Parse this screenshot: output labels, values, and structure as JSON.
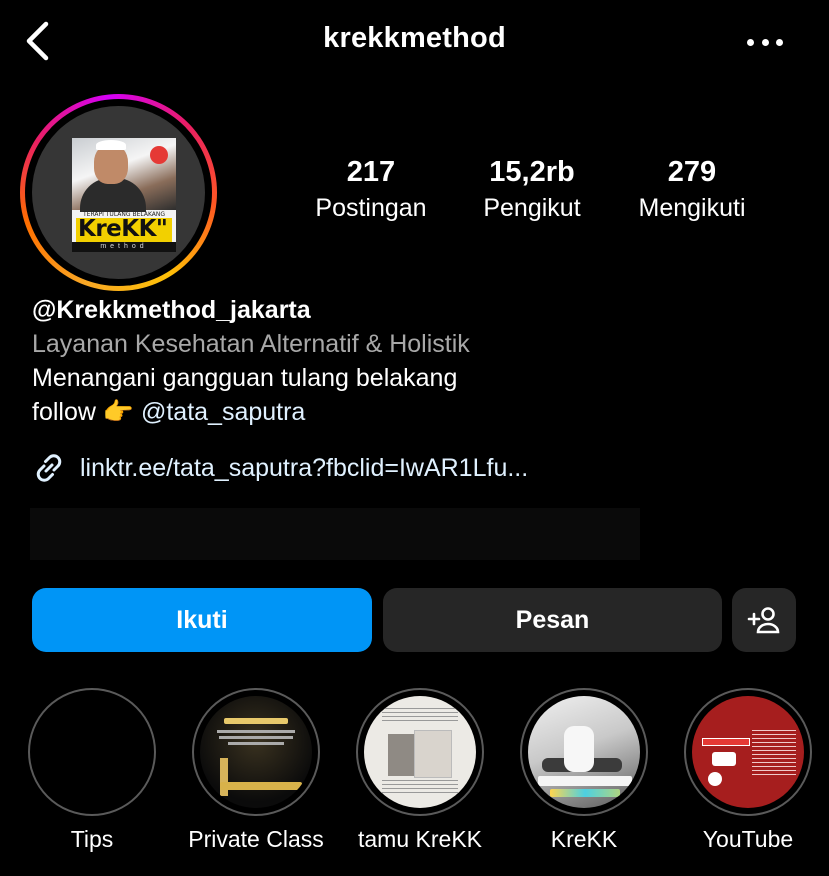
{
  "header": {
    "title": "krekkmethod",
    "back_icon": "chevron-left-icon",
    "more_icon": "more-horizontal-icon"
  },
  "avatar": {
    "logo_tagline": "TERAPI TULANG BELAKANG DENGAN",
    "logo_text": "KreKK\"",
    "logo_sub": "method"
  },
  "stats": {
    "posts": {
      "value": "217",
      "label": "Postingan"
    },
    "followers": {
      "value": "15,2rb",
      "label": "Pengikut"
    },
    "following": {
      "value": "279",
      "label": "Mengikuti"
    }
  },
  "bio": {
    "username": "@Krekkmethod_jakarta",
    "category": "Layanan Kesehatan Alternatif & Holistik",
    "line1": "Menangani gangguan tulang belakang",
    "line2_prefix": "follow",
    "line2_emoji": "👉",
    "line2_mention": "@tata_saputra",
    "link": "linktr.ee/tata_saputra?fbclid=IwAR1Lfu..."
  },
  "actions": {
    "follow_label": "Ikuti",
    "message_label": "Pesan",
    "add_user_icon": "add-person-icon"
  },
  "highlights": [
    {
      "label": "Tips"
    },
    {
      "label": "Private Class"
    },
    {
      "label": "tamu KreKK"
    },
    {
      "label": "KreKK"
    },
    {
      "label": "YouTube"
    }
  ],
  "colors": {
    "background": "#000000",
    "primary_button": "#0095f6",
    "secondary_button": "#262626",
    "link": "#e0f1ff",
    "muted_text": "#a8a8a8"
  }
}
